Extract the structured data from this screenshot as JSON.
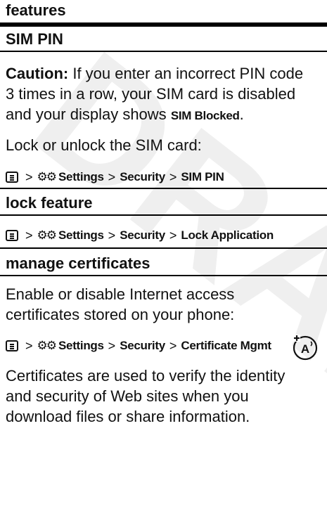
{
  "section_header": "features",
  "sim_pin": {
    "title": "SIM PIN",
    "caution_label": "Caution:",
    "caution_lines": [
      "If you enter an incorrect PIN code",
      "3 times in a row, your SIM card is disabled",
      "and your display shows"
    ],
    "blocked_text": "SIM Blocked",
    "period": ".",
    "lock_text": "Lock or unlock the SIM card:",
    "path": [
      "Settings",
      "Security",
      "SIM PIN"
    ]
  },
  "lock_feature": {
    "title": "lock feature",
    "path": [
      "Settings",
      "Security",
      "Lock Application"
    ]
  },
  "manage_certificates": {
    "title": "manage certificates",
    "desc_lines": [
      "Enable or disable Internet access",
      "certificates stored on your phone:"
    ],
    "path": [
      "Settings",
      "Security",
      "Certificate Mgmt"
    ],
    "note_lines": [
      "Certificates are used to verify the identity",
      "and security of Web sites when you",
      "download files or share information."
    ]
  },
  "watermark_text": "DRAFT",
  "separator": ">"
}
